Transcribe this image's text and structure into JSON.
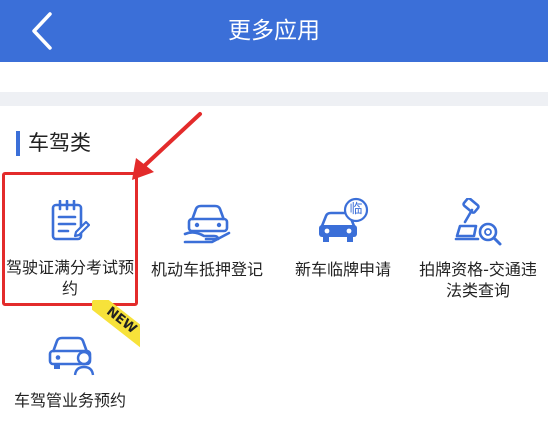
{
  "header": {
    "title": "更多应用",
    "back_icon": "chevron-left-icon",
    "bg": "#3b6fd8"
  },
  "section": {
    "title": "车驾类",
    "accent": "#3b6fd8"
  },
  "apps": [
    {
      "label": "驾驶证满分考试预约",
      "icon": "clipboard-icon",
      "highlighted": true
    },
    {
      "label": "机动车抵押登记",
      "icon": "car-hand-icon"
    },
    {
      "label": "新车临牌申请",
      "icon": "car-temp-plate-icon",
      "badge_char": "临"
    },
    {
      "label": "拍牌资格-交通违法类查询",
      "icon": "gavel-search-icon"
    },
    {
      "label": "车驾管业务预约",
      "icon": "car-service-icon",
      "ribbon": "NEW"
    }
  ],
  "colors": {
    "icon_blue": "#3b6fd8",
    "highlight_red": "#e32b2b",
    "ribbon_yellow": "#f7e23a"
  }
}
